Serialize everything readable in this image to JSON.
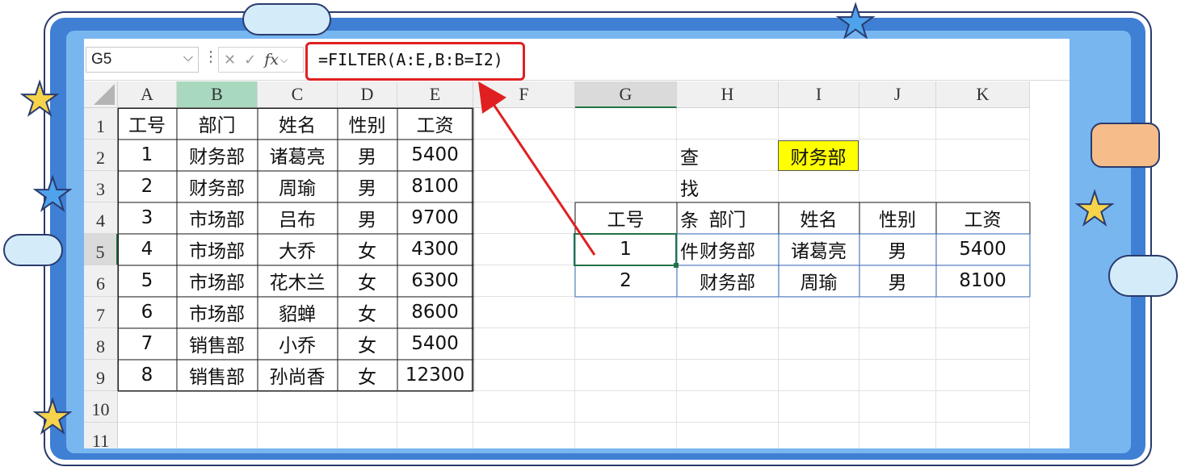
{
  "formula_bar": {
    "name_box": "G5",
    "cancel_glyph": "✕",
    "confirm_glyph": "✓",
    "fx_label": "fx",
    "formula": "=FILTER(A:E,B:B=I2)"
  },
  "columns": [
    "A",
    "B",
    "C",
    "D",
    "E",
    "F",
    "G",
    "H",
    "I",
    "J",
    "K"
  ],
  "rows": [
    "1",
    "2",
    "3",
    "4",
    "5",
    "6",
    "7",
    "8",
    "9",
    "10",
    "11"
  ],
  "source_table": {
    "headers": [
      "工号",
      "部门",
      "姓名",
      "性别",
      "工资"
    ],
    "records": [
      [
        "1",
        "财务部",
        "诸葛亮",
        "男",
        "5400"
      ],
      [
        "2",
        "财务部",
        "周瑜",
        "男",
        "8100"
      ],
      [
        "3",
        "市场部",
        "吕布",
        "男",
        "9700"
      ],
      [
        "4",
        "市场部",
        "大乔",
        "女",
        "4300"
      ],
      [
        "5",
        "市场部",
        "花木兰",
        "女",
        "6300"
      ],
      [
        "6",
        "市场部",
        "貂蝉",
        "女",
        "8600"
      ],
      [
        "7",
        "销售部",
        "小乔",
        "女",
        "5400"
      ],
      [
        "8",
        "销售部",
        "孙尚香",
        "女",
        "12300"
      ]
    ]
  },
  "criteria": {
    "label": "查找条件",
    "value": "财务部"
  },
  "result_table": {
    "headers": [
      "工号",
      "部门",
      "姓名",
      "性别",
      "工资"
    ],
    "records": [
      [
        "1",
        "财务部",
        "诸葛亮",
        "男",
        "5400"
      ],
      [
        "2",
        "财务部",
        "周瑜",
        "男",
        "8100"
      ]
    ]
  },
  "colors": {
    "highlight_yellow": "#ffff00",
    "annotation_red": "#e02020",
    "selection_green": "#217346"
  }
}
